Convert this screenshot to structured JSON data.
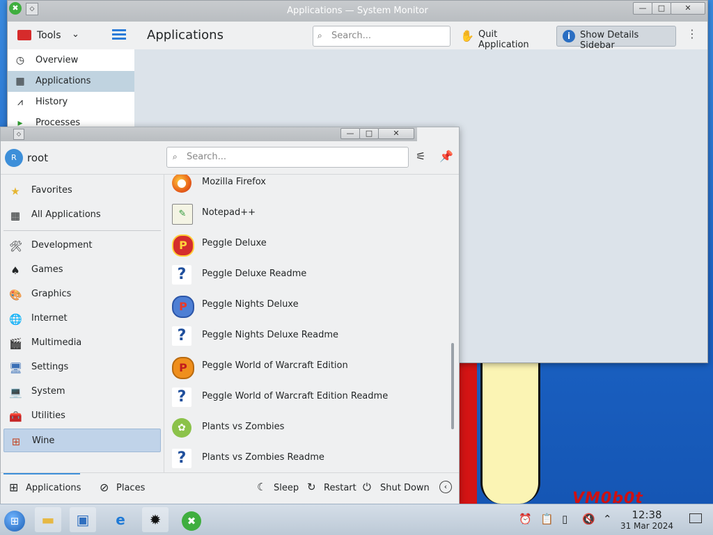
{
  "system_monitor": {
    "window_title": "Applications — System Monitor",
    "tools_label": "Tools",
    "page_title": "Applications",
    "search_placeholder": "Search...",
    "quit_label": "Quit Application",
    "details_label": "Show Details Sidebar",
    "sidebar": [
      {
        "label": "Overview",
        "icon": "gauge-icon"
      },
      {
        "label": "Applications",
        "icon": "grid-icon"
      },
      {
        "label": "History",
        "icon": "chart-icon"
      },
      {
        "label": "Processes",
        "icon": "play-icon"
      }
    ]
  },
  "menu": {
    "user": "root",
    "avatar_letter": "R",
    "search_placeholder": "Search...",
    "categories": [
      {
        "label": "Favorites",
        "icon": "folder-star-icon"
      },
      {
        "label": "All Applications",
        "icon": "all-apps-icon"
      },
      {
        "label": "Development",
        "icon": "development-icon"
      },
      {
        "label": "Games",
        "icon": "games-icon"
      },
      {
        "label": "Graphics",
        "icon": "graphics-icon"
      },
      {
        "label": "Internet",
        "icon": "internet-icon"
      },
      {
        "label": "Multimedia",
        "icon": "multimedia-icon"
      },
      {
        "label": "Settings",
        "icon": "settings-icon"
      },
      {
        "label": "System",
        "icon": "system-icon"
      },
      {
        "label": "Utilities",
        "icon": "utilities-icon"
      },
      {
        "label": "Wine",
        "icon": "wine-icon"
      }
    ],
    "apps": [
      {
        "label": "Mozilla Firefox",
        "icon": "firefox-icon"
      },
      {
        "label": "Notepad++",
        "icon": "notepad-icon"
      },
      {
        "label": "Peggle Deluxe",
        "icon": "peggle-icon"
      },
      {
        "label": "Peggle Deluxe Readme",
        "icon": "help-icon"
      },
      {
        "label": "Peggle Nights Deluxe",
        "icon": "peggle-nights-icon"
      },
      {
        "label": "Peggle Nights Deluxe Readme",
        "icon": "help-icon"
      },
      {
        "label": "Peggle World of Warcraft Edition",
        "icon": "peggle-wow-icon"
      },
      {
        "label": "Peggle World of Warcraft Edition Readme",
        "icon": "help-icon"
      },
      {
        "label": "Plants vs Zombies",
        "icon": "pvz-icon"
      },
      {
        "label": "Plants vs Zombies Readme",
        "icon": "help-icon"
      }
    ],
    "footer": {
      "applications_tab": "Applications",
      "places_tab": "Places",
      "sleep": "Sleep",
      "restart": "Restart",
      "shutdown": "Shut Down"
    }
  },
  "taskbar": {
    "time": "12:38",
    "date": "31 Mar 2024"
  },
  "desktop": {
    "watermark": "VM0b0t"
  }
}
